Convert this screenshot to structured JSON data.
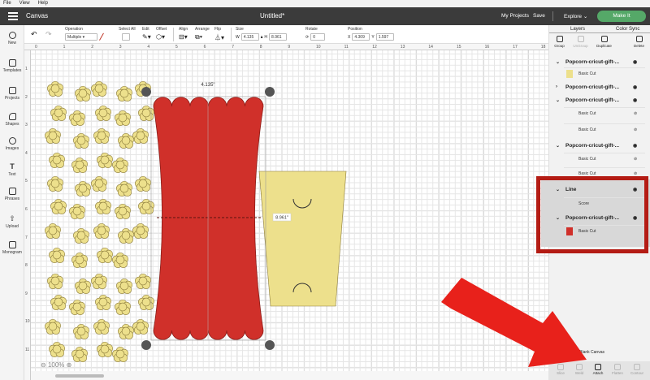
{
  "menubar": {
    "items": [
      "File",
      "View",
      "Help"
    ]
  },
  "appbar": {
    "title": "Canvas",
    "document": "Untitled*",
    "my_projects": "My Projects",
    "save": "Save",
    "explore": "Explore",
    "make_it": "Make It",
    "make_it_color": "#55a868"
  },
  "toolbar": {
    "operation_label": "Operation",
    "operation_value": "Multiple",
    "select_all": "Select All",
    "edit": "Edit",
    "offset": "Offset",
    "align": "Align",
    "arrange": "Arrange",
    "flip": "Flip",
    "size": "Size",
    "w_label": "W",
    "w_value": "4.135",
    "h_label": "H",
    "h_value": "8.961",
    "rotate": "Rotate",
    "rotate_value": "0",
    "position": "Position",
    "x_label": "X",
    "x_value": "4.309",
    "y_label": "Y",
    "y_value": "1.597"
  },
  "leftnav": {
    "items": [
      "New",
      "Templates",
      "Projects",
      "Shapes",
      "Images",
      "Text",
      "Phrases",
      "Upload",
      "Monogram"
    ]
  },
  "ruler": {
    "top": [
      "0",
      "1",
      "2",
      "3",
      "4",
      "5",
      "6",
      "7",
      "8",
      "9",
      "10",
      "11",
      "12",
      "13",
      "14",
      "15",
      "16",
      "17",
      "18"
    ],
    "left": [
      "1",
      "2",
      "3",
      "4",
      "5",
      "6",
      "7",
      "8",
      "9",
      "10",
      "11"
    ]
  },
  "canvas": {
    "width_label": "4.135\"",
    "height_label": "8.961\"",
    "zoom": "100%",
    "red_color": "#d0302a",
    "yellow_color": "#ede08c"
  },
  "rightpanel": {
    "tabs": [
      "Layers",
      "Color Sync"
    ],
    "tools": [
      "Group",
      "UnGroup",
      "Duplicate",
      "Delete"
    ],
    "layers": [
      {
        "name": "Popcorn-cricut-gift-...",
        "sub": [
          "Basic Cut"
        ]
      },
      {
        "name": "Popcorn-cricut-gift-...",
        "sub": []
      },
      {
        "name": "Popcorn-cricut-gift-...",
        "sub": [
          "Basic Cut",
          "Basic Cut"
        ]
      },
      {
        "name": "Popcorn-cricut-gift-...",
        "sub": [
          "Basic Cut",
          "Basic Cut"
        ]
      },
      {
        "name": "Line",
        "sub": [
          "Score"
        ]
      },
      {
        "name": "Popcorn-cricut-gift-...",
        "sub": [
          "Basic Cut"
        ]
      }
    ],
    "blank_canvas": "Blank Canvas",
    "bottom_tools": [
      "Slice",
      "Weld",
      "Attach",
      "Flatten",
      "Contour"
    ]
  },
  "annotation": {
    "arrow_color": "#e8211b",
    "box_color": "#b41c14"
  }
}
